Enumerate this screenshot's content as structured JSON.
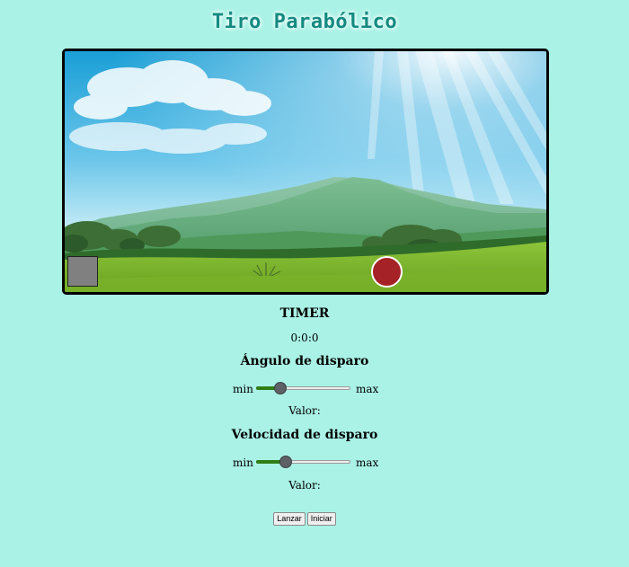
{
  "title": "Tiro Parabólico",
  "stage": {
    "launcher_color": "#808080",
    "ball_color": "#a52226"
  },
  "timer": {
    "heading": "TIMER",
    "value": "0:0:0"
  },
  "angle": {
    "heading": "Ángulo de disparo",
    "min_label": "min",
    "max_label": "max",
    "value_label": "Valor:",
    "slider_fraction": 0.22
  },
  "velocity": {
    "heading": "Velocidad de disparo",
    "min_label": "min",
    "max_label": "max",
    "value_label": "Valor:",
    "slider_fraction": 0.29
  },
  "buttons": {
    "launch": "Lanzar",
    "start": "Iniciar"
  },
  "colors": {
    "background": "#aaf2e6",
    "title": "#138a80",
    "slider_fill": "#2f7e16"
  }
}
